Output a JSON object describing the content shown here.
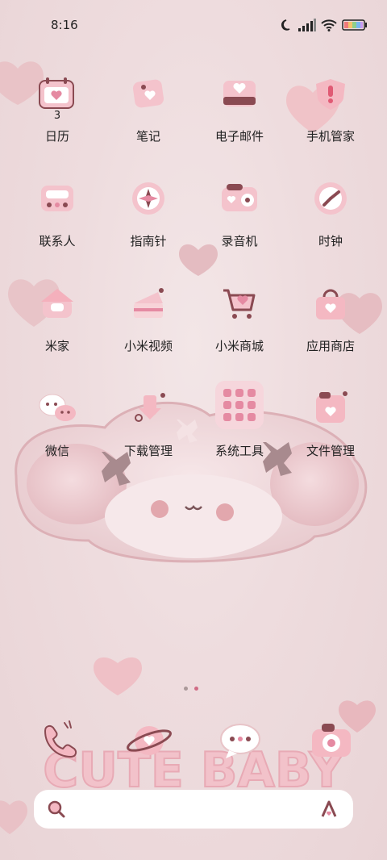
{
  "status_bar": {
    "time": "8:16"
  },
  "apps": [
    {
      "label": "日历",
      "badge": "3"
    },
    {
      "label": "笔记"
    },
    {
      "label": "电子邮件"
    },
    {
      "label": "手机管家"
    },
    {
      "label": "联系人"
    },
    {
      "label": "指南针"
    },
    {
      "label": "录音机"
    },
    {
      "label": "时钟"
    },
    {
      "label": "米家"
    },
    {
      "label": "小米视频"
    },
    {
      "label": "小米商城"
    },
    {
      "label": "应用商店"
    },
    {
      "label": "微信"
    },
    {
      "label": "下载管理"
    },
    {
      "label": "系统工具"
    },
    {
      "label": "文件管理"
    }
  ],
  "wallpaper_text": "CUTE BABY",
  "page_indicator": {
    "pages": 2,
    "current": 2
  },
  "dock": [
    "phone-icon",
    "browser-icon",
    "messages-icon",
    "camera-icon"
  ],
  "colors": {
    "accent": "#e58aa2",
    "deep": "#8a4a52",
    "bg": "#f0e0e2"
  }
}
